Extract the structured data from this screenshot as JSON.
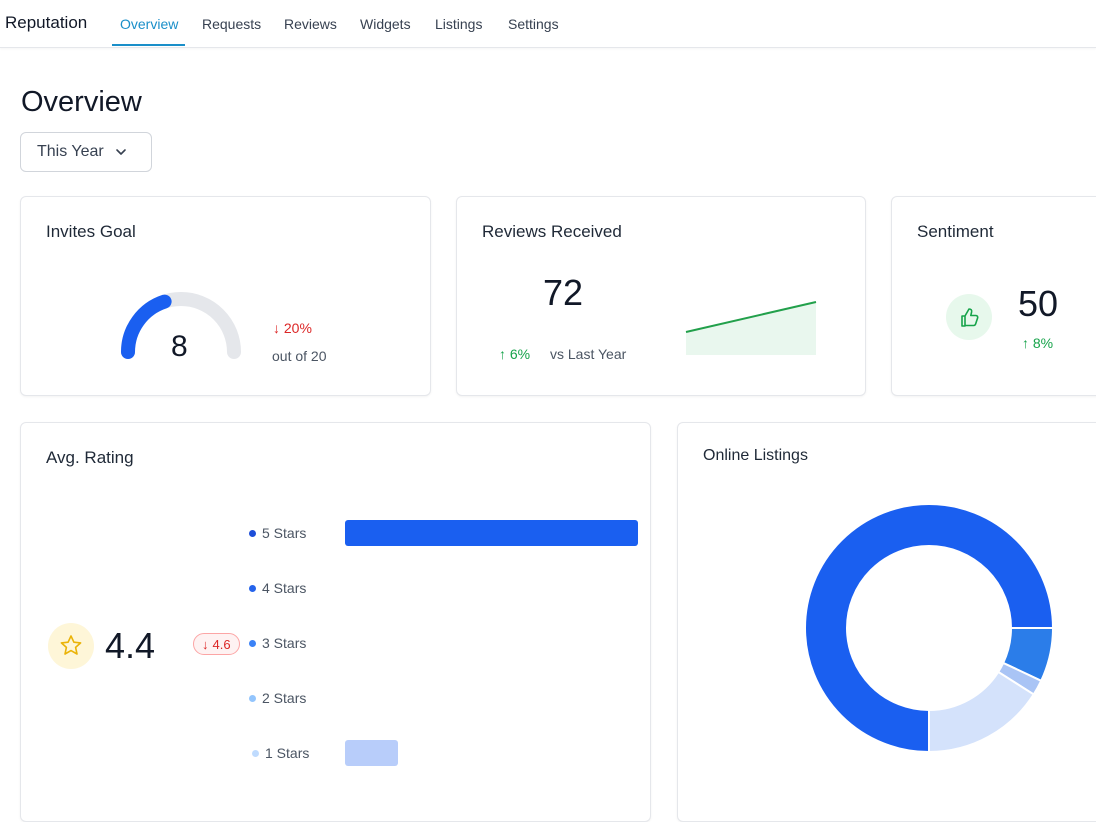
{
  "nav": {
    "brand": "Reputation",
    "tabs": [
      {
        "label": "Overview",
        "active": true
      },
      {
        "label": "Requests"
      },
      {
        "label": "Reviews"
      },
      {
        "label": "Widgets"
      },
      {
        "label": "Listings"
      },
      {
        "label": "Settings"
      }
    ]
  },
  "page": {
    "title": "Overview",
    "filter_label": "This Year"
  },
  "invites": {
    "title": "Invites Goal",
    "value": "8",
    "goal_value": 8,
    "goal_total": 20,
    "delta": "20%",
    "out_of": "out of 20"
  },
  "reviews": {
    "title": "Reviews Received",
    "value": "72",
    "delta": "6%",
    "compare": "vs Last Year"
  },
  "sentiment": {
    "title": "Sentiment",
    "value": "50",
    "delta": "8%"
  },
  "rating": {
    "title": "Avg. Rating",
    "value": "4.4",
    "delta": "4.6",
    "distribution": [
      {
        "label": "5 Stars",
        "share": 1.0,
        "dot_color": "#1d4ed8",
        "bar_color": "#1a5ff0"
      },
      {
        "label": "4 Stars",
        "share": 0.0,
        "dot_color": "#2563eb",
        "bar_color": "#2563eb"
      },
      {
        "label": "3 Stars",
        "share": 0.0,
        "dot_color": "#3b82f6",
        "bar_color": "#3b82f6"
      },
      {
        "label": "2 Stars",
        "share": 0.0,
        "dot_color": "#93c5fd",
        "bar_color": "#93c5fd"
      },
      {
        "label": "1 Stars",
        "share": 0.18,
        "dot_color": "#bfdbfe",
        "bar_color": "#b8cdfa"
      }
    ]
  },
  "listings": {
    "title": "Online Listings",
    "segments": [
      {
        "value": 75,
        "color": "#1a5ff0"
      },
      {
        "value": 7,
        "color": "#2b7de9"
      },
      {
        "value": 2,
        "color": "#a9c4f5"
      },
      {
        "value": 16,
        "color": "#d4e2fb"
      }
    ]
  },
  "colors": {
    "accent": "#1a8fc9",
    "primary_blue": "#1a5ff0",
    "positive": "#16a34a",
    "negative": "#dc2626"
  }
}
